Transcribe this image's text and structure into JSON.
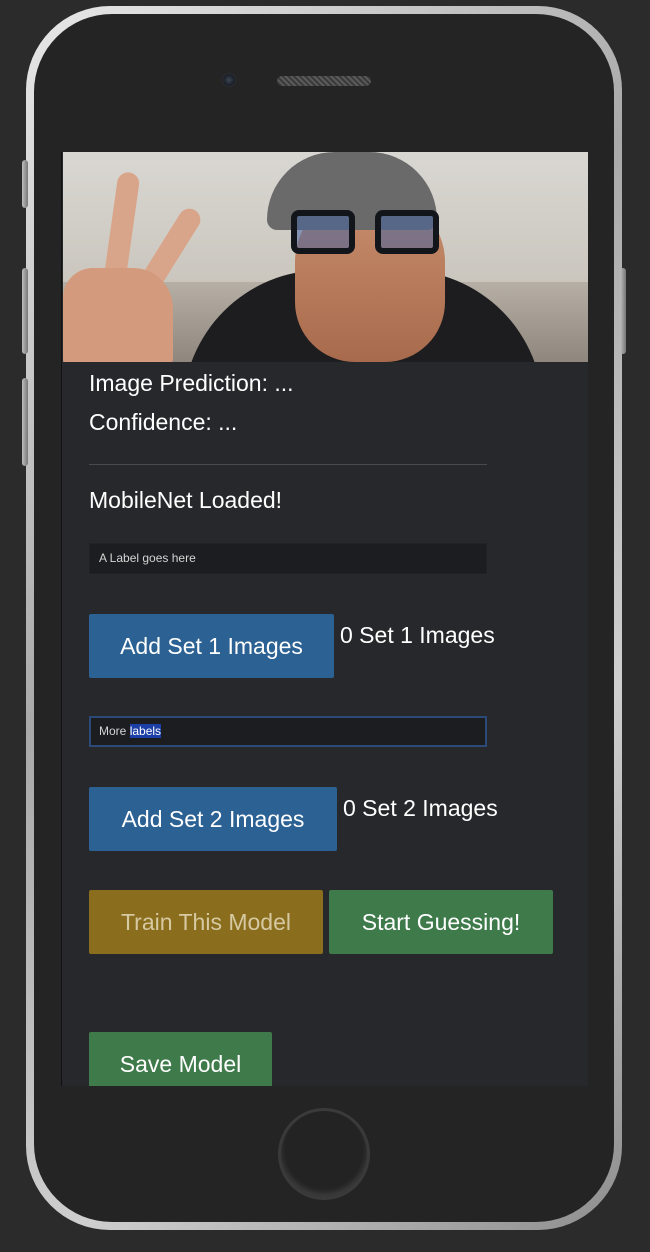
{
  "webcam": {
    "label": "webcam-feed"
  },
  "prediction": {
    "image_prediction": "Image Prediction: ...",
    "confidence": "Confidence: ..."
  },
  "status": {
    "message": "MobileNet Loaded!"
  },
  "set1": {
    "label_value": "A Label goes here",
    "button_label": "Add Set 1 Images",
    "count_text": "0 Set 1 Images"
  },
  "set2": {
    "label_prefix": "More ",
    "label_selected": "labels",
    "button_label": "Add Set 2 Images",
    "count_text": "0 Set 2 Images"
  },
  "actions": {
    "train_label": "Train This Model",
    "guess_label": "Start Guessing!",
    "save_label": "Save Model"
  },
  "colors": {
    "screen_bg": "#27282b",
    "blue_button": "#2c6193",
    "gold_button": "#8a6e1e",
    "green_button": "#3e7a4a",
    "text_selection": "#1b3fa6"
  }
}
